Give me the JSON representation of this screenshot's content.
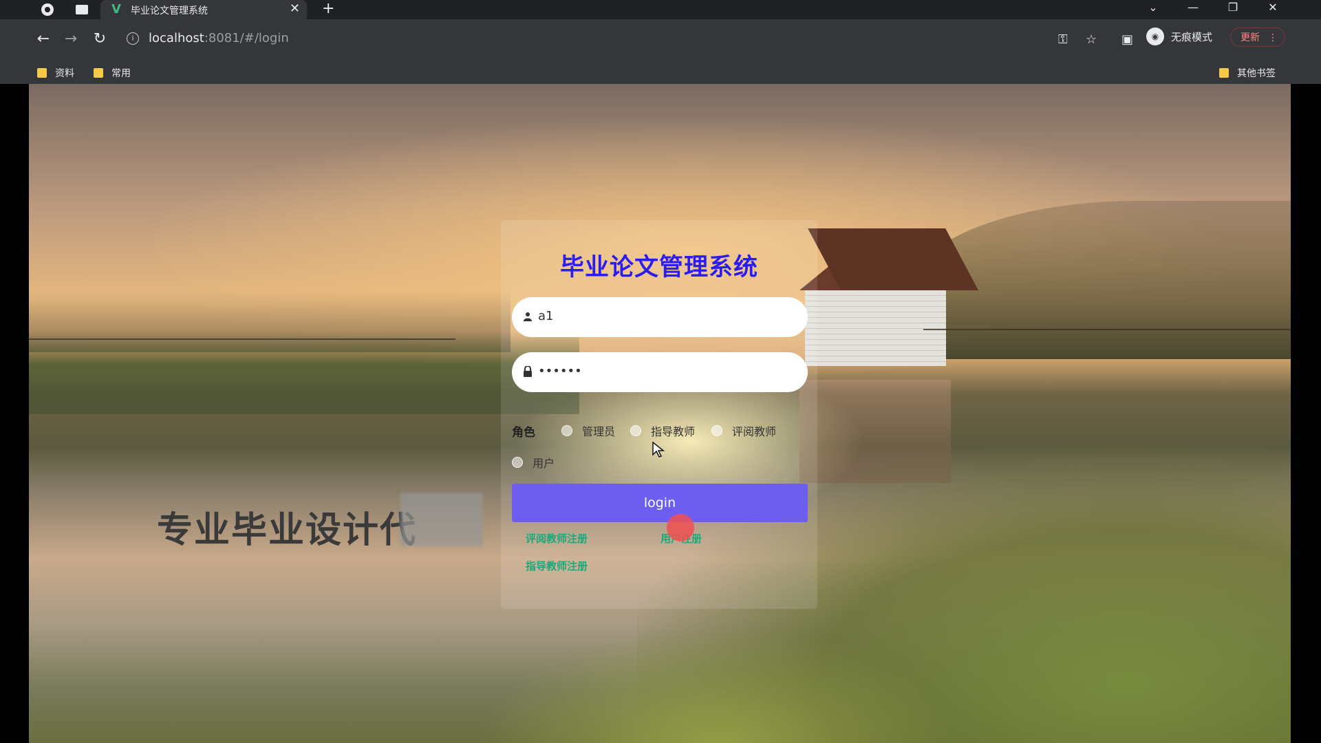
{
  "browser": {
    "tab_title": "毕业论文管理系统",
    "url_host": "localhost",
    "url_rest": ":8081/#/login",
    "incognito_label": "无痕模式",
    "update_label": "更新",
    "bookmarks": [
      "资料",
      "常用"
    ],
    "other_bookmarks": "其他书签"
  },
  "login": {
    "title": "毕业论文管理系统",
    "username_value": "a1",
    "password_value": "••••••",
    "role_label": "角色",
    "roles": [
      "管理员",
      "指导教师",
      "评阅教师",
      "用户"
    ],
    "login_button": "login",
    "links": {
      "reviewer_register": "评阅教师注册",
      "user_register": "用户注册",
      "advisor_register": "指导教师注册"
    }
  },
  "watermark_text": "专业毕业设计代",
  "colors": {
    "title": "#2b1df2",
    "login_button": "#6d5ef0",
    "link": "#1aa97a"
  }
}
